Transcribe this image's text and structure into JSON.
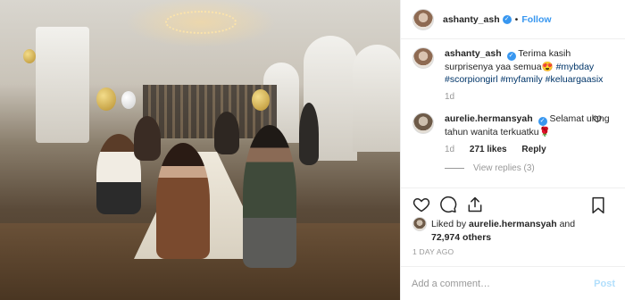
{
  "post": {
    "username": "ashanty_ash",
    "follow_label": "Follow",
    "dot": "•",
    "caption_text": "Terima kasih surprisenya yaa semua😍",
    "hashtags": [
      "#mybday",
      "#scorpiongirl",
      "#myfamily",
      "#keluargaasix"
    ],
    "caption_age": "1d"
  },
  "comment": {
    "username": "aurelie.hermansyah",
    "text": "Selamat ulang tahun wanita terkuatku🌹",
    "age": "1d",
    "likes": "271 likes",
    "reply_label": "Reply",
    "view_replies": "View replies (3)"
  },
  "likes": {
    "liked_by_prefix": "Liked by",
    "liked_by_user": "aurelie.hermansyah",
    "and": "and",
    "others": "72,974 others"
  },
  "time_ago": "1 DAY AGO",
  "add_comment": {
    "placeholder": "Add a comment…",
    "post_label": "Post"
  },
  "colors": {
    "link": "#3897f0",
    "hashtag": "#003569",
    "muted": "#999999",
    "post_disabled": "#b2dffc"
  },
  "icons": [
    "heart-icon",
    "comment-icon",
    "share-icon",
    "bookmark-icon",
    "verified-badge-icon"
  ]
}
